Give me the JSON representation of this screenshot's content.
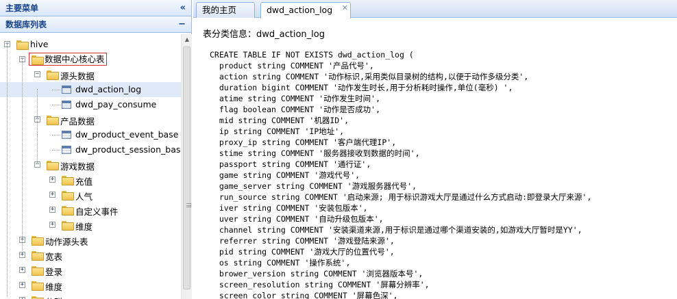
{
  "left_panel": {
    "main_menu_title": "主要菜单",
    "collapse_glyph": "«",
    "db_list_title": "数据库列表",
    "db_list_tool": "−"
  },
  "tree": [
    {
      "label": "hive",
      "expander": "−",
      "level": 0,
      "icon": "folder-icon"
    },
    {
      "label": "数据中心核心表",
      "expander": "−",
      "level": 1,
      "icon": "folder-icon",
      "highlighted": true
    },
    {
      "label": "源头数据",
      "expander": "−",
      "level": 2,
      "icon": "folder-icon"
    },
    {
      "label": "dwd_action_log",
      "expander": "",
      "level": 3,
      "icon": "table-icon",
      "selected": true
    },
    {
      "label": "dwd_pay_consume",
      "expander": "",
      "level": 3,
      "icon": "table-icon"
    },
    {
      "label": "产品数据",
      "expander": "−",
      "level": 2,
      "icon": "folder-icon"
    },
    {
      "label": "dw_product_event_base",
      "expander": "",
      "level": 3,
      "icon": "table-icon"
    },
    {
      "label": "dw_product_session_base",
      "expander": "",
      "level": 3,
      "icon": "table-icon"
    },
    {
      "label": "游戏数据",
      "expander": "−",
      "level": 2,
      "icon": "folder-icon"
    },
    {
      "label": "充值",
      "expander": "+",
      "level": 3,
      "icon": "folder-icon"
    },
    {
      "label": "人气",
      "expander": "+",
      "level": 3,
      "icon": "folder-icon"
    },
    {
      "label": "自定义事件",
      "expander": "+",
      "level": 3,
      "icon": "folder-icon"
    },
    {
      "label": "维度",
      "expander": "+",
      "level": 3,
      "icon": "folder-icon"
    },
    {
      "label": "动作源头表",
      "expander": "+",
      "level": 1,
      "icon": "folder-icon"
    },
    {
      "label": "宽表",
      "expander": "+",
      "level": 1,
      "icon": "folder-icon"
    },
    {
      "label": "登录",
      "expander": "+",
      "level": 1,
      "icon": "folder-icon"
    },
    {
      "label": "维度",
      "expander": "+",
      "level": 1,
      "icon": "folder-icon"
    },
    {
      "label": "分群",
      "expander": "+",
      "level": 1,
      "icon": "folder-icon"
    }
  ],
  "tabs": [
    {
      "label": "我的主页",
      "active": false,
      "closable": false
    },
    {
      "label": "dwd_action_log",
      "active": true,
      "closable": true
    }
  ],
  "content": {
    "title_prefix": "表分类信息：",
    "title_table": "dwd_action_log",
    "code_lines": [
      "CREATE TABLE IF NOT EXISTS dwd_action_log (",
      "  product string COMMENT '产品代号',",
      "  action string COMMENT '动作标识,采用类似目录树的结构,以便于动作多级分类',",
      "  duration bigint COMMENT '动作发生时长,用于分析耗时操作,单位(毫秒) ',",
      "  atime string COMMENT '动作发生时间',",
      "  flag boolean COMMENT '动作是否成功',",
      "  mid string COMMENT '机器ID',",
      "  ip string COMMENT 'IP地址',",
      "  proxy_ip string COMMENT '客户端代理IP',",
      "  stime string COMMENT '服务器接收到数据的时间',",
      "  passport string COMMENT '通行证',",
      "  game string COMMENT '游戏代号',",
      "  game_server string COMMENT '游戏服务器代号',",
      "  run_source string COMMENT '启动来源; 用于标识游戏大厅是通过什么方式启动:即登录大厅来源',",
      "  iver string COMMENT '安装包版本',",
      "  uver string COMMENT '自动升级包版本',",
      "  channel string COMMENT '安装渠道来源,用于标识是通过哪个渠道安装的,如游戏大厅暂时是YY',",
      "  referrer string COMMENT '游戏登陆来源',",
      "  pid string COMMENT '游戏大厅的位置代号',",
      "  os string COMMENT '操作系统',",
      "  brower_version string COMMENT '浏览器版本号',",
      "  screen_resolution string COMMENT '屏幕分辨率',",
      "  screen_color string COMMENT '屏幕色深',"
    ]
  },
  "colors": {
    "header_text": "#15428b",
    "panel_border": "#99bbe8",
    "selected_row": "#dfe8f6",
    "highlight_box": "#d43030"
  }
}
